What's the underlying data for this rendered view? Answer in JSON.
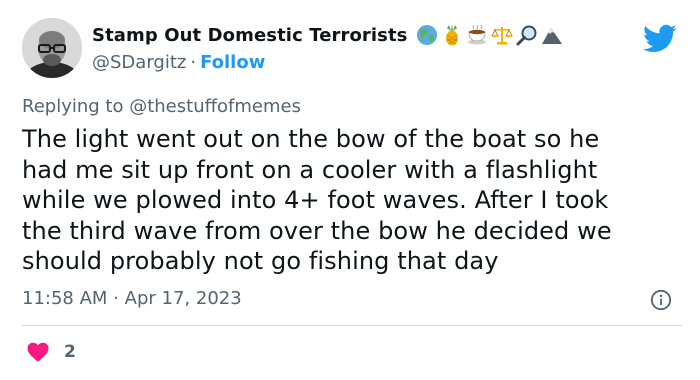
{
  "user": {
    "display_name": "Stamp Out Domestic Terrorists",
    "name_emojis": [
      "globe-emoji",
      "pineapple-emoji",
      "teacup-emoji",
      "scales-emoji",
      "magnifier-emoji",
      "mountain-emoji"
    ],
    "handle": "@SDargitz",
    "separator": "·",
    "follow_label": "Follow"
  },
  "reply": {
    "prefix": "Replying to",
    "handle": "@thestuffofmemes"
  },
  "tweet": {
    "lines": [
      "The light went out on the bow of the boat so he",
      "had me sit up front on a cooler with a flashlight",
      "while we plowed into 4+ foot waves. After I took",
      "the third wave from over the bow he decided we",
      "should probably not go fishing that day"
    ],
    "time": "11:58 AM",
    "separator": "·",
    "date": "Apr 17, 2023"
  },
  "actions": {
    "like_count": "2"
  },
  "colors": {
    "accent": "#1d9bf0",
    "heart": "#f91880",
    "muted_text": "#536471",
    "divider": "#cfd9de"
  }
}
